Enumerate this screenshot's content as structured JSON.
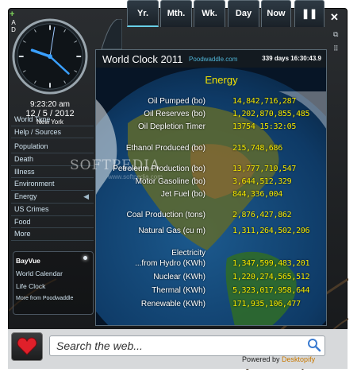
{
  "clock": {
    "time": "9:23:20 am",
    "date": "12 / 5 / 2012",
    "city": "New York",
    "side_label": "A D"
  },
  "left_nav": [
    "World Time",
    "Help / Sources",
    "Population",
    "Death",
    "Illness",
    "Environment",
    "Energy",
    "US Crimes",
    "Food",
    "More"
  ],
  "bottom_links": [
    "BayVue",
    "World Calendar",
    "Life Clock",
    "More from Poodwaddle"
  ],
  "tabs": [
    "Yr.",
    "Mth.",
    "Wk.",
    "Day",
    "Now"
  ],
  "header": {
    "title": "World Clock 2011",
    "site": "Poodwaddle.com",
    "elapsed": "339 days 16:30:43.9"
  },
  "section": "Energy",
  "rows": [
    {
      "label": "Oil Pumped (bo)",
      "value": "14,842,716,287"
    },
    {
      "label": "Oil Reserves (bo)",
      "value": "1,202,870,855,485"
    },
    {
      "label": "Oil Depletion Timer",
      "value": "13754   15:32:05"
    },
    {
      "label": "Ethanol Produced (bo)",
      "value": "215,748,686"
    },
    {
      "label": "Petroleum Production (bo)",
      "value": "13,777,710,547"
    },
    {
      "label": "Motor Gasoline (bo)",
      "value": "3,644,512,329"
    },
    {
      "label": "Jet Fuel (bo)",
      "value": "844,336,004"
    },
    {
      "label": "Coal Production (tons)",
      "value": "2,876,427,862"
    },
    {
      "label": "Natural Gas (cu m)",
      "value": "1,311,264,502,206"
    },
    {
      "label": "Electricity",
      "value": ""
    },
    {
      "label": "...from Hydro (KWh)",
      "value": "1,347,599,483,201"
    },
    {
      "label": "Nuclear (KWh)",
      "value": "1,220,274,565,512"
    },
    {
      "label": "Thermal (KWh)",
      "value": "5,323,017,958,644"
    },
    {
      "label": "Renewable (KWh)",
      "value": "171,935,106,477"
    }
  ],
  "search": {
    "placeholder": "Search the web...",
    "powered_by": "Powered by",
    "brand": "Desktopify"
  },
  "watermark": {
    "text": "SOFTPEDIA",
    "url": "www.softpedia.com"
  },
  "colors": {
    "value_yellow": "#f7eb00",
    "title_yellow": "#f2e200",
    "link_blue": "#4fb4d6",
    "tab_accent": "#68d0e8"
  }
}
